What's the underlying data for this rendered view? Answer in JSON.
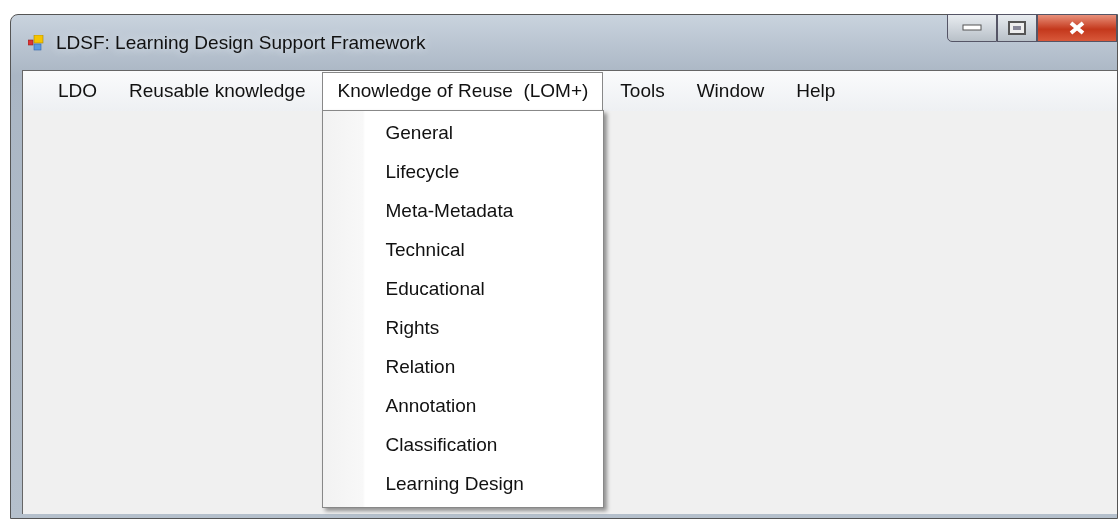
{
  "window": {
    "title": "LDSF: Learning Design Support Framework"
  },
  "menu_bar": [
    {
      "label": "LDO",
      "open": false
    },
    {
      "label": "Reusable knowledge",
      "open": false
    },
    {
      "label": "Knowledge of Reuse  (LOM+)",
      "open": true,
      "items": [
        "General",
        "Lifecycle",
        "Meta-Metadata",
        "Technical",
        "Educational",
        "Rights",
        "Relation",
        "Annotation",
        "Classification",
        "Learning Design"
      ]
    },
    {
      "label": "Tools",
      "open": false
    },
    {
      "label": "Window",
      "open": false
    },
    {
      "label": "Help",
      "open": false
    }
  ]
}
